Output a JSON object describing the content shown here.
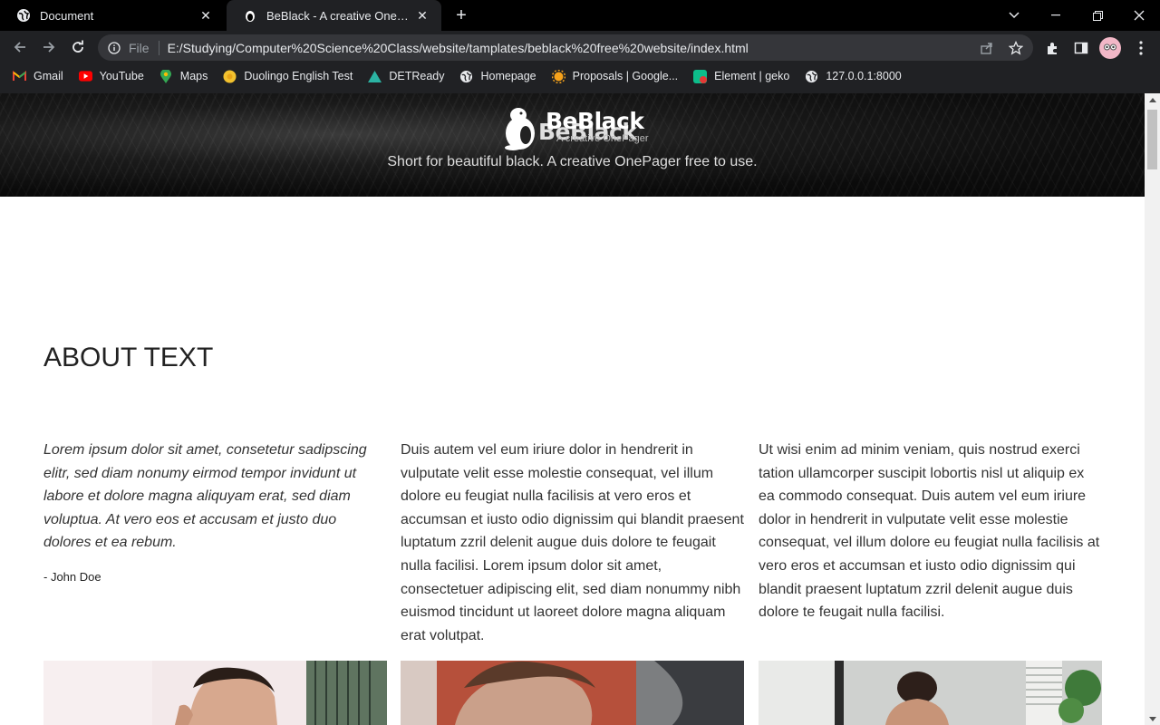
{
  "browser": {
    "tabs": [
      {
        "title": "Document",
        "icon": "globe-icon",
        "active": false
      },
      {
        "title": "BeBlack - A creative OnePager free",
        "icon": "beaver-favicon-icon",
        "active": true
      }
    ],
    "address": {
      "scheme": "File",
      "url": "E:/Studying/Computer%20Science%20Class/website/tamplates/beblack%20free%20website/index.html"
    },
    "bookmarks": [
      {
        "label": "Gmail",
        "icon": "gmail-icon"
      },
      {
        "label": "YouTube",
        "icon": "youtube-icon"
      },
      {
        "label": "Maps",
        "icon": "maps-icon"
      },
      {
        "label": "Duolingo English Test",
        "icon": "duolingo-icon"
      },
      {
        "label": "DETReady",
        "icon": "detready-icon"
      },
      {
        "label": "Homepage",
        "icon": "globe-icon"
      },
      {
        "label": "Proposals | Google...",
        "icon": "proposals-icon"
      },
      {
        "label": "Element | geko",
        "icon": "element-icon"
      },
      {
        "label": "127.0.0.1:8000",
        "icon": "globe-icon"
      }
    ],
    "colors": {
      "chrome_bg": "#202124",
      "tabstrip_bg": "#000000",
      "omnibox_bg": "#35363a"
    }
  },
  "hero": {
    "brand": "BeBlack",
    "brand_ghost": "BeBlack",
    "brand_sub": "A creative OnePager",
    "tagline": "Short for beautiful black. A creative OnePager free to use."
  },
  "about": {
    "heading": "ABOUT TEXT",
    "quote": "Lorem ipsum dolor sit amet, consetetur sadipscing elitr, sed diam nonumy eirmod tempor invidunt ut labore et dolore magna aliquyam erat, sed diam voluptua. At vero eos et accusam et justo duo dolores et ea rebum.",
    "author": "- John Doe",
    "col2": "Duis autem vel eum iriure dolor in hendrerit in vulputate velit esse molestie consequat, vel illum dolore eu feugiat nulla facilisis at vero eros et accumsan et iusto odio dignissim qui blandit praesent luptatum zzril delenit augue duis dolore te feugait nulla facilisi. Lorem ipsum dolor sit amet, consectetuer adipiscing elit, sed diam nonummy nibh euismod tincidunt ut laoreet dolore magna aliquam erat volutpat.",
    "col3": "Ut wisi enim ad minim veniam, quis nostrud exerci tation ullamcorper suscipit lobortis nisl ut aliquip ex ea commodo consequat. Duis autem vel eum iriure dolor in hendrerit in vulputate velit esse molestie consequat, vel illum dolore eu feugiat nulla facilisis at vero eros et accumsan et iusto odio dignissim qui blandit praesent luptatum zzril delenit augue duis dolore te feugait nulla facilisi."
  }
}
